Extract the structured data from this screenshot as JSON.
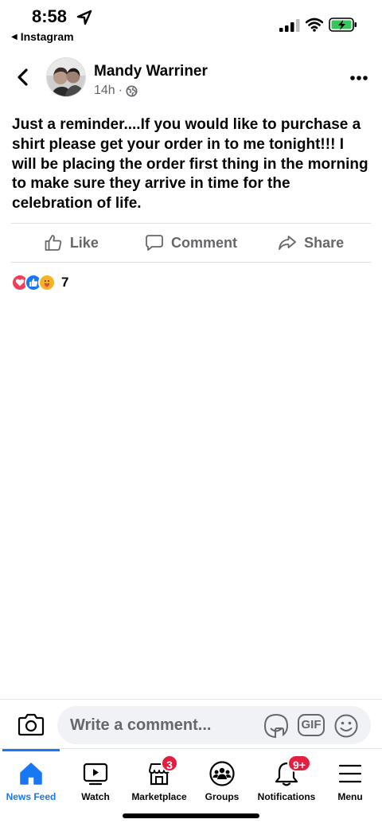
{
  "status_bar": {
    "time": "8:58",
    "back_app": "Instagram"
  },
  "post": {
    "author": "Mandy Warriner",
    "time_ago": "14h",
    "separator": "·",
    "privacy_icon": "globe-icon",
    "body": "Just a reminder....If you would like to purchase a shirt please get your order in to me tonight!!! I will be placing the order first thing in the morning to make sure they arrive in time for the celebration of life.",
    "reaction_count": "7"
  },
  "actions": {
    "like": "Like",
    "comment": "Comment",
    "share": "Share"
  },
  "composer": {
    "placeholder": "Write a comment...",
    "gif_label": "GIF"
  },
  "tabbar": {
    "items": [
      {
        "label": "News Feed",
        "icon": "home-icon",
        "active": true
      },
      {
        "label": "Watch",
        "icon": "watch-icon"
      },
      {
        "label": "Marketplace",
        "icon": "marketplace-icon",
        "badge": "3"
      },
      {
        "label": "Groups",
        "icon": "groups-icon"
      },
      {
        "label": "Notifications",
        "icon": "bell-icon",
        "badge": "9+"
      },
      {
        "label": "Menu",
        "icon": "menu-icon"
      }
    ]
  },
  "colors": {
    "accent": "#1877f2",
    "badge": "#e41e3f",
    "secondary_text": "#65676b",
    "battery": "#34c759"
  }
}
